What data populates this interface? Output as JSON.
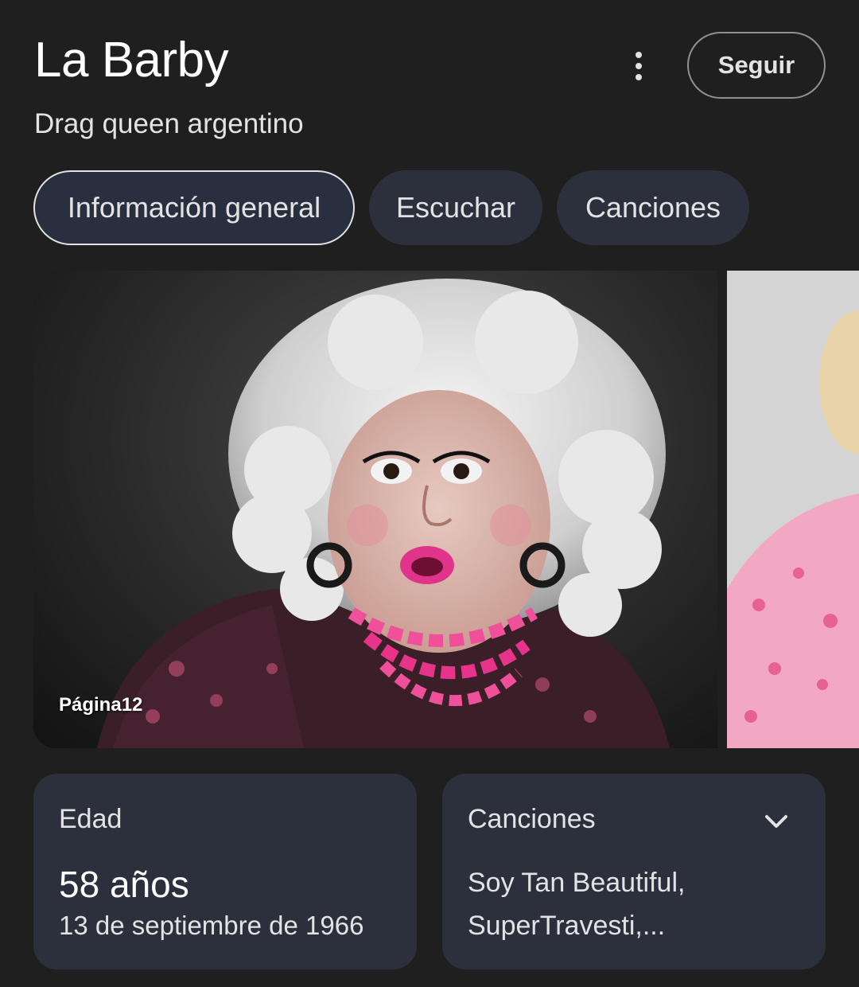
{
  "header": {
    "title": "La Barby",
    "subtitle": "Drag queen argentino",
    "follow_label": "Seguir",
    "more_icon": "more-vert-icon"
  },
  "tabs": [
    {
      "label": "Información general",
      "active": true
    },
    {
      "label": "Escuchar",
      "active": false
    },
    {
      "label": "Canciones",
      "active": false
    }
  ],
  "images": {
    "main_source": "Página12"
  },
  "cards": {
    "age": {
      "label": "Edad",
      "value": "58 años",
      "date": "13 de septiembre de 1966"
    },
    "songs": {
      "label": "Canciones",
      "text": "Soy Tan Beautiful, SuperTravesti,...",
      "icon": "chevron-down-icon"
    }
  },
  "colors": {
    "background": "#1f1f1f",
    "chip": "#2b303c",
    "card": "#2b303c",
    "text": "#e3e3e3",
    "accent_pink": "#e8338a"
  }
}
